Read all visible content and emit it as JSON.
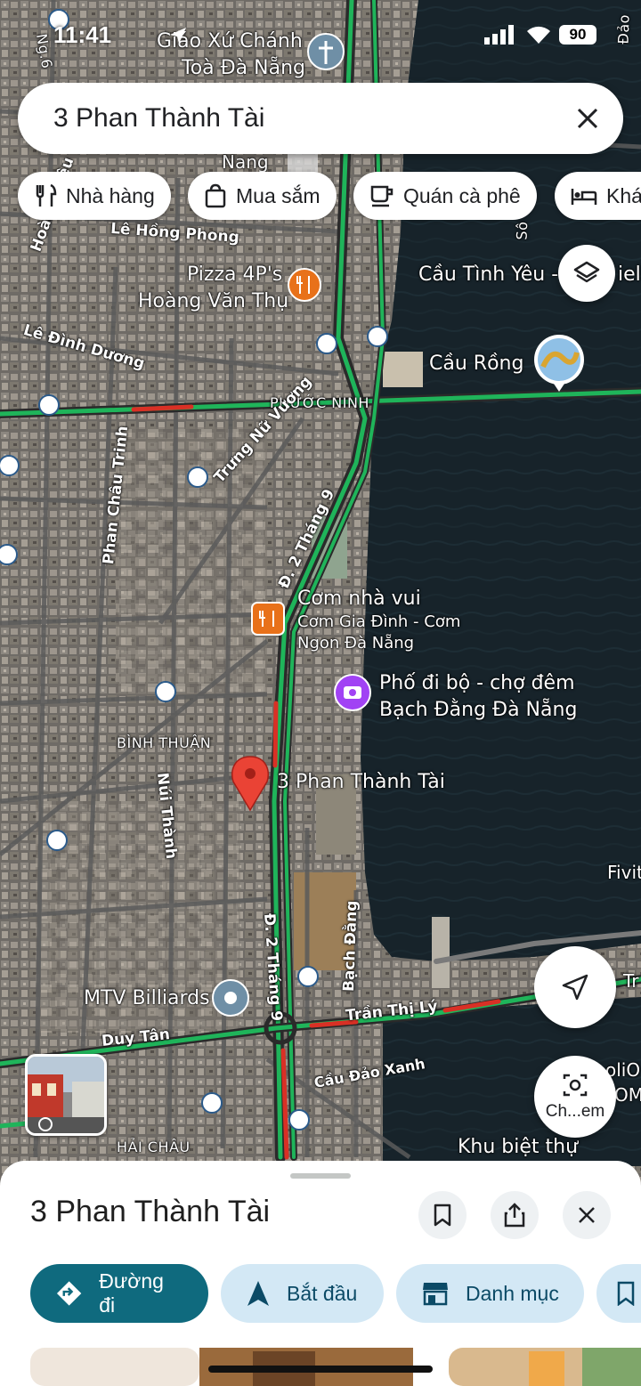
{
  "status_bar": {
    "time": "11:41",
    "battery": "90"
  },
  "search": {
    "query": "3 Phan Thành Tài"
  },
  "chips": [
    {
      "label": "Nhà hàng",
      "icon": "fork-knife-icon"
    },
    {
      "label": "Mua sắm",
      "icon": "shopping-bag-icon"
    },
    {
      "label": "Quán cà phê",
      "icon": "coffee-icon"
    },
    {
      "label": "Khá",
      "icon": "bed-icon"
    }
  ],
  "map": {
    "labels": {
      "giao_xu_1": "Giáo Xứ Chánh",
      "giao_xu_2": "Toà Đà Nẵng",
      "nang": "Nang",
      "ngo": "Ng.6",
      "le_hong_phong": "Lê Hồng Phong",
      "hoang_dieu": "Hoàng Diệu",
      "pizza_1": "Pizza 4P's",
      "pizza_2": "Hoàng Văn Thụ",
      "cau_tinh_yeu": "Cầu Tình Yêu -",
      "cau_tinh_yeu_tail": "iel",
      "le_dinh_duong": "Lê Đình Dương",
      "cau_rong": "Cầu Rồng",
      "phuoc_ninh": "PHƯỚC NINH",
      "trung_nu_vuong": "Trưng Nữ Vương",
      "phan_chau_trinh": "Phan Châu Trinh",
      "d2thang9_top": "Đ. 2 Tháng 9",
      "com_nha_vui": "Cơm nhà vui",
      "com_gia_dinh_1": "Cơm Gia Đình - Cơm",
      "com_gia_dinh_2": "Ngon Đà Nẵng",
      "pho_di_bo_1": "Phố đi bộ - chợ đêm",
      "pho_di_bo_2": "Bạch Đằng Đà Nẵng",
      "binh_thuan": "BÌNH THUẬN",
      "nui_thanh": "Núi Thành",
      "pin_label": "3 Phan Thành Tài",
      "fivit": "Fivit",
      "d2thang9_bottom": "Đ. 2 Tháng 9",
      "bach_dang": "Bạch Đằng",
      "mtv_billiards": "MTV Billiards",
      "tran_thi_ly": "Trần Thị Lý",
      "duy_tan": "Duy Tân",
      "cau_dao_xanh": "Cầu Đảo Xanh",
      "hai_chau": "HẢI CHÂU",
      "khu_biet_thu": "Khu biệt thự",
      "so_partial": "Sô",
      "dao_partial": "Đảo",
      "tr_partial": "Tr",
      "oli_partial": "oliO",
      "om_partial": "OM"
    },
    "lens_label": "Ch...em"
  },
  "sheet": {
    "title": "3 Phan Thành Tài",
    "actions": [
      {
        "label": "Đường đi",
        "icon": "directions-icon"
      },
      {
        "label": "Bắt đầu",
        "icon": "navigation-arrow-icon"
      },
      {
        "label": "Danh mục",
        "icon": "store-icon"
      }
    ]
  },
  "colors": {
    "primary": "#0f6a7e",
    "tonal": "#d3e8f5",
    "traffic_green": "#1fb45a",
    "traffic_red": "#d93025",
    "pin": "#ea4335"
  }
}
